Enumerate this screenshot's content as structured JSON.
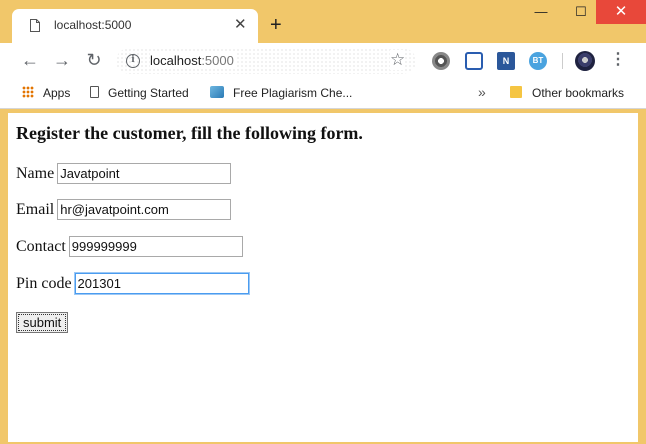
{
  "tab": {
    "title": "localhost:5000",
    "close": "✕",
    "new_tab": "+"
  },
  "window": {
    "minimize": "—",
    "maximize": "☐",
    "close": "✕"
  },
  "toolbar": {
    "back": "←",
    "forward": "→",
    "reload": "↻",
    "url_host": "localhost",
    "url_port": ":5000",
    "menu": "⋮",
    "ext_onenote": "N",
    "ext_bt": "BT"
  },
  "bookmarks": {
    "apps": "Apps",
    "getting_started": "Getting Started",
    "plagiarism": "Free Plagiarism Che...",
    "more": "»",
    "other": "Other bookmarks"
  },
  "form": {
    "heading": "Register the customer, fill the following form.",
    "name_label": "Name",
    "name_value": "Javatpoint",
    "email_label": "Email",
    "email_value": "hr@javatpoint.com",
    "contact_label": "Contact",
    "contact_value": "999999999",
    "pin_label": "Pin code",
    "pin_value": "201301",
    "submit_label": "submit"
  }
}
